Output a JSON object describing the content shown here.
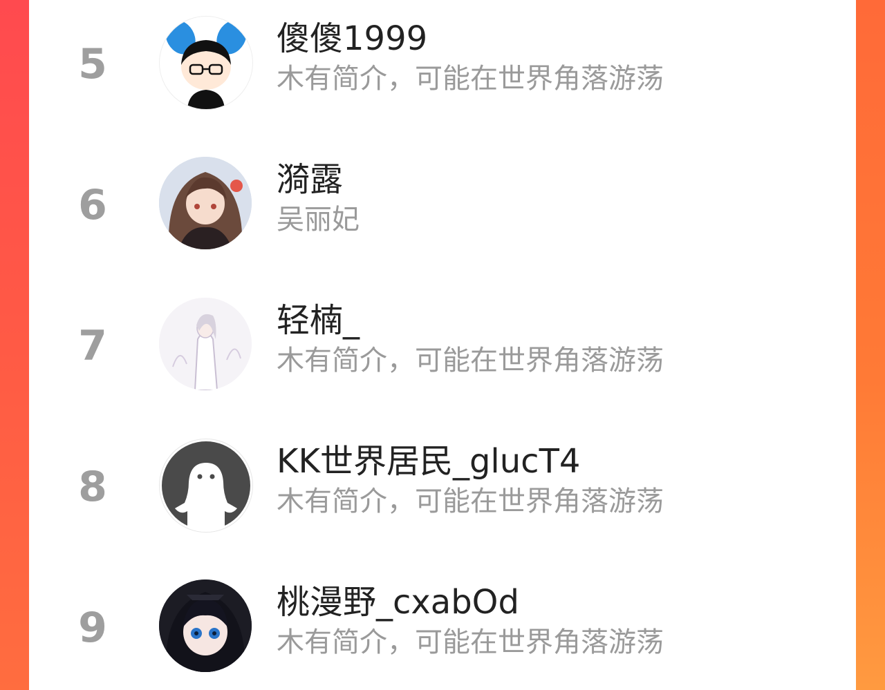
{
  "users": [
    {
      "rank": "5",
      "name": "傻傻1999",
      "bio": "木有简介，可能在世界角落游荡",
      "avatar_icon": "cartoon-boy-bunny-ears-avatar"
    },
    {
      "rank": "6",
      "name": "漪露",
      "bio": "吴丽妃",
      "avatar_icon": "anime-girl-brown-hair-avatar"
    },
    {
      "rank": "7",
      "name": "轻楠_",
      "bio": "木有简介，可能在世界角落游荡",
      "avatar_icon": "anime-white-robe-figure-avatar"
    },
    {
      "rank": "8",
      "name": "KK世界居民_glucT4",
      "bio": "木有简介，可能在世界角落游荡",
      "avatar_icon": "default-ghost-avatar"
    },
    {
      "rank": "9",
      "name": "桃漫野_cxabOd",
      "bio": "木有简介，可能在世界角落游荡",
      "avatar_icon": "anime-dark-hair-blue-eyes-avatar"
    }
  ],
  "colors": {
    "accent_left": "#ff4a4f",
    "accent_right": "#ff7a36",
    "rank_gray": "#9e9e9e",
    "name_text": "#222222",
    "bio_text": "#9a9a9a"
  }
}
